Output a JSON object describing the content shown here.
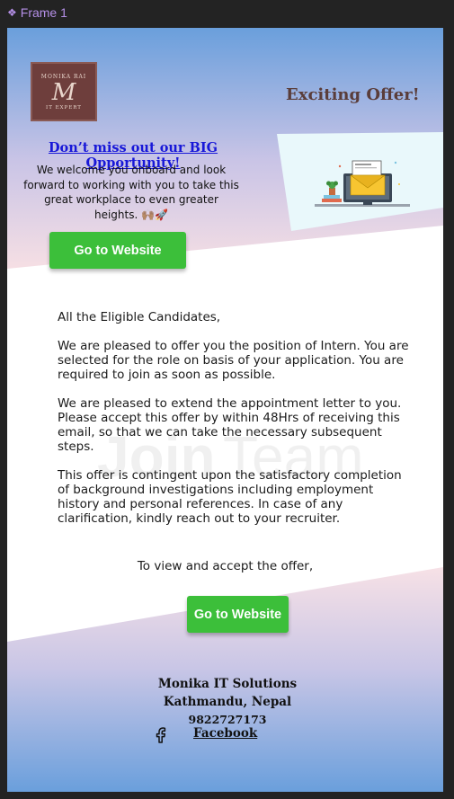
{
  "frame": {
    "label": "Frame 1",
    "icon": "component-diamond-icon"
  },
  "logo": {
    "top_text": "MONIKA RAI",
    "monogram": "M",
    "bottom_text": "IT EXPERT"
  },
  "header": {
    "headline": "Exciting Offer!"
  },
  "hero": {
    "opportunity_link": "Don’t miss out our BIG Opportunity!",
    "welcome_text": "We welcome you onboard and look forward to working with you to take this great workplace to even greater heights. 🙌🏽🚀",
    "illustration": "newsletter-laptop-illustration",
    "cta_top": "Go to Website"
  },
  "watermark": {
    "word1": "Join",
    "word2": "Team"
  },
  "letter": {
    "salutation": "All the Eligible Candidates,",
    "paragraph1": "We are pleased to offer you the position of Intern. You are selected for the role on basis of your application. You are required to join as soon as possible.",
    "paragraph2": "We are pleased to extend the appointment letter to you. Please accept this offer by within 48Hrs of receiving this email, so that we can take the necessary subsequent steps.",
    "paragraph3": "This offer is contingent upon the satisfactory completion of background investigations including employment history and personal references. In case of any clarification, kindly reach out to your recruiter."
  },
  "cta": {
    "view_line": "To view and accept the offer,",
    "cta_bottom": "Go to Website"
  },
  "footer": {
    "company": "Monika IT Solutions",
    "city": "Kathmandu, Nepal",
    "phone": "9822727173",
    "facebook_label": " Facebook",
    "facebook_icon": "facebook-icon"
  },
  "colors": {
    "button": "#3cbf3a",
    "top_blue": "#6ea0db",
    "link_blue": "#1818d8",
    "headline_brown": "#5a3d3a",
    "logo_brown": "#6e3e3c",
    "frame_label": "#b48fe6"
  }
}
